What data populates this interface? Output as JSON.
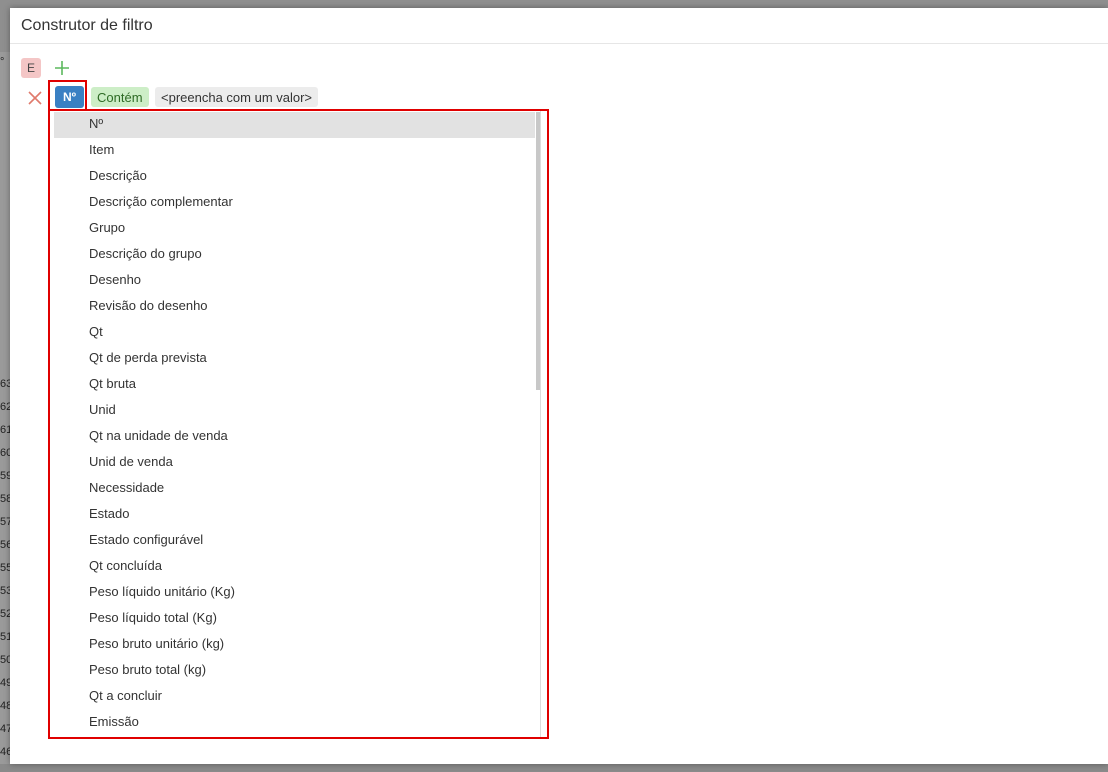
{
  "background": {
    "degree": "°",
    "row_numbers": [
      "63",
      "62",
      "61",
      "60",
      "59",
      "58",
      "57",
      "56",
      "55",
      "53",
      "52",
      "51",
      "50",
      "49",
      "48",
      "47",
      "46"
    ]
  },
  "dialog": {
    "title": "Construtor de filtro"
  },
  "group": {
    "operator": "E"
  },
  "condition": {
    "field": "Nº",
    "operator": "Contém",
    "value_placeholder": "<preencha com um valor>"
  },
  "field_list": {
    "items": [
      "Nº",
      "Item",
      "Descrição",
      "Descrição complementar",
      "Grupo",
      "Descrição do grupo",
      "Desenho",
      "Revisão do desenho",
      "Qt",
      "Qt de perda prevista",
      "Qt bruta",
      "Unid",
      "Qt na unidade de venda",
      "Unid de venda",
      "Necessidade",
      "Estado",
      "Estado configurável",
      "Qt concluída",
      "Peso líquido unitário (Kg)",
      "Peso líquido total (Kg)",
      "Peso bruto unitário (kg)",
      "Peso bruto total (kg)",
      "Qt a concluir",
      "Emissão"
    ],
    "selected_index": 0
  },
  "colors": {
    "field_chip": "#3a80c3",
    "operator_chip": "#cdeec7",
    "group_operator": "#f4c6c6",
    "highlight_frame": "#e00000"
  },
  "icons": {
    "add": "plus-icon",
    "remove": "close-icon"
  }
}
